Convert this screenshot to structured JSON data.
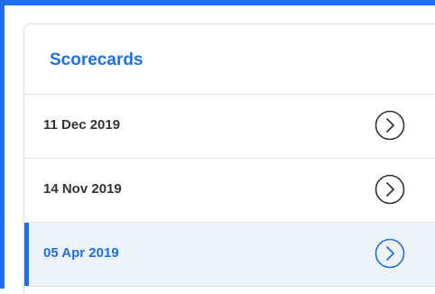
{
  "panel": {
    "title": "Scorecards"
  },
  "scorecards": [
    {
      "date": "11 Dec 2019",
      "icon": "chevron-right-circle-icon",
      "selected": false
    },
    {
      "date": "14 Nov 2019",
      "icon": "chevron-right-circle-icon",
      "selected": false
    },
    {
      "date": "05 Apr 2019",
      "icon": "chevron-right-circle-icon",
      "selected": true
    }
  ],
  "colors": {
    "accent": "#1f6fe8",
    "text": "#333333",
    "selected_background": "#eef2f9",
    "divider": "#e1e1e1"
  }
}
